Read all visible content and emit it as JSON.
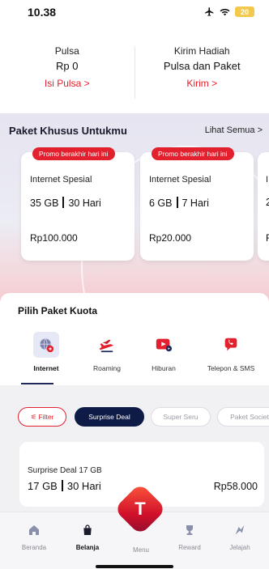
{
  "status_bar": {
    "time": "10.38",
    "battery": "20"
  },
  "balance": {
    "left": {
      "label": "Pulsa",
      "value": "Rp 0",
      "link": "Isi Pulsa  >"
    },
    "right": {
      "label": "Kirim Hadiah",
      "value": "Pulsa dan Paket",
      "link": "Kirim  >"
    }
  },
  "promo": {
    "title": "Paket Khusus Untukmu",
    "see_all": "Lihat Semua  >",
    "cards": [
      {
        "badge": "Promo berakhir hari ini",
        "title": "Internet Spesial",
        "quota": "35 GB",
        "duration": "30 Hari",
        "price": "Rp100.000"
      },
      {
        "badge": "Promo berakhir hari ini",
        "title": "Internet Spesial",
        "quota": "6 GB",
        "duration": "7 Hari",
        "price": "Rp20.000"
      },
      {
        "title": "I",
        "quota": "2",
        "price": "R"
      }
    ]
  },
  "kuota": {
    "title": "Pilih Paket Kuota",
    "categories": [
      {
        "label": "Internet",
        "icon": "globe-icon"
      },
      {
        "label": "Roaming",
        "icon": "plane-icon"
      },
      {
        "label": "Hiburan",
        "icon": "play-icon"
      },
      {
        "label": "Telepon & SMS",
        "icon": "phone-icon"
      }
    ]
  },
  "filters": {
    "filter_label": "Filter",
    "chips": [
      "Surprise Deal",
      "Super Seru",
      "Paket Societ"
    ]
  },
  "package": {
    "name": "Surprise Deal 17 GB",
    "quota": "17 GB",
    "duration": "30 Hari",
    "price": "Rp58.000"
  },
  "nav": {
    "items": [
      {
        "label": "Beranda",
        "icon": "home-icon"
      },
      {
        "label": "Belanja",
        "icon": "shopping-bag-icon"
      },
      {
        "label": "Menu",
        "icon": "telkomsel-logo-icon"
      },
      {
        "label": "Reward",
        "icon": "trophy-icon"
      },
      {
        "label": "Jelajah",
        "icon": "compass-icon"
      }
    ],
    "fab_letter": "T"
  },
  "colors": {
    "accent": "#e3202d",
    "navy": "#0f1b47"
  }
}
